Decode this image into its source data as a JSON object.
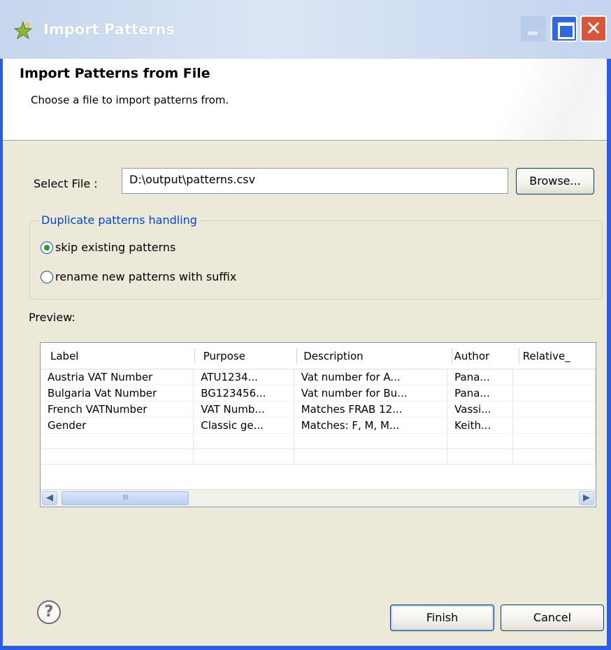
{
  "window": {
    "title": "Import Patterns",
    "app_icon": "sparkle-icon",
    "controls": {
      "minimize_icon": "minimize-icon",
      "maximize_icon": "maximize-icon",
      "close_icon": "close-icon"
    }
  },
  "header": {
    "title": "Import Patterns from File",
    "description": "Choose a file to import patterns from."
  },
  "file": {
    "label": "Select File :",
    "value": "D:\\output\\patterns.csv",
    "browse_label": "Browse..."
  },
  "duplicates": {
    "legend": "Duplicate patterns handling",
    "options": [
      {
        "label": "skip existing patterns",
        "selected": true
      },
      {
        "label": "rename new patterns with suffix",
        "selected": false
      }
    ]
  },
  "preview": {
    "label": "Preview:",
    "columns": [
      "Label",
      "Purpose",
      "Description",
      "Author",
      "Relative_"
    ],
    "rows": [
      [
        "Austria VAT Number",
        "ATU1234...",
        "Vat number for A...",
        "Pana...",
        ""
      ],
      [
        "Bulgaria Vat Number",
        "BG123456...",
        "Vat number for Bu...",
        "Pana...",
        ""
      ],
      [
        "French VATNumber",
        "VAT Numb...",
        "Matches FRAB 12...",
        "Vassi...",
        ""
      ],
      [
        "Gender",
        "Classic ge...",
        "Matches: F, M, M...",
        "Keith...",
        ""
      ]
    ],
    "scroll": {
      "left_icon": "scroll-left-icon",
      "right_icon": "scroll-right-icon",
      "thumb_grip": "IIII"
    }
  },
  "footer": {
    "help_icon": "help-icon",
    "finish_label": "Finish",
    "cancel_label": "Cancel"
  },
  "colors": {
    "title_bar": "#c6d6ee",
    "window_border": "#2a5ee0",
    "dialog_bg": "#ece9d8",
    "group_legend": "#0046d5",
    "radio_dot": "#21a121"
  }
}
